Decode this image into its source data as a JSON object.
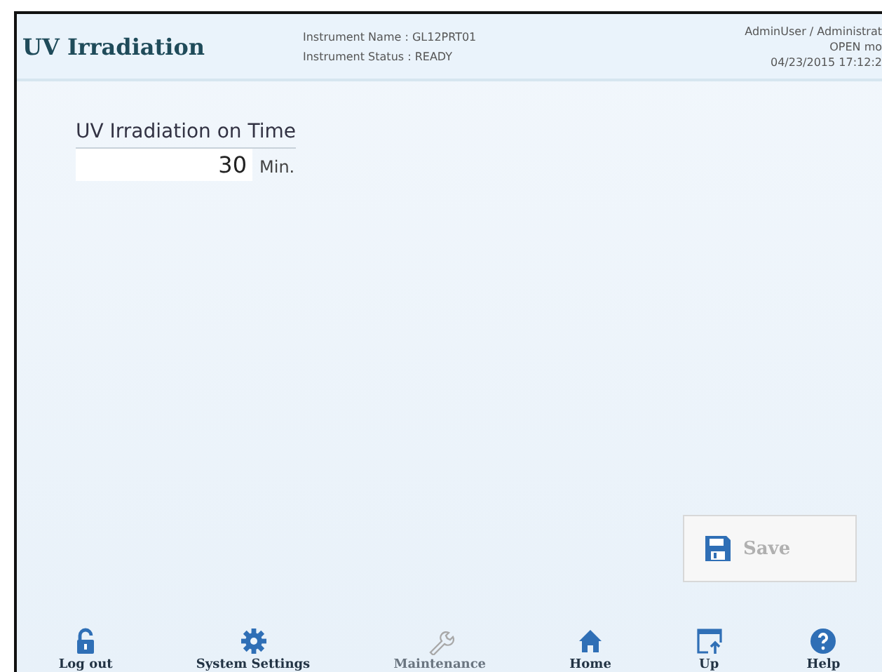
{
  "header": {
    "title": "UV Irradiation",
    "instrument_name": "Instrument Name : GL12PRT01",
    "instrument_status": "Instrument Status : READY",
    "user": "AdminUser / Administrat",
    "mode": "OPEN mo",
    "datetime": "04/23/2015 17:12:2"
  },
  "setting": {
    "label": "UV Irradiation on Time",
    "value": "30",
    "unit": "Min."
  },
  "save_button": {
    "label": "Save",
    "disabled": true
  },
  "nav": [
    {
      "kind": "unlock",
      "label": "Log out",
      "disabled": false
    },
    {
      "kind": "gear",
      "label": "System Settings",
      "disabled": false
    },
    {
      "kind": "wrench",
      "label": "Maintenance",
      "disabled": true
    },
    {
      "kind": "home",
      "label": "Home",
      "disabled": false
    },
    {
      "kind": "up",
      "label": "Up",
      "disabled": false
    },
    {
      "kind": "help",
      "label": "Help",
      "disabled": false
    }
  ]
}
